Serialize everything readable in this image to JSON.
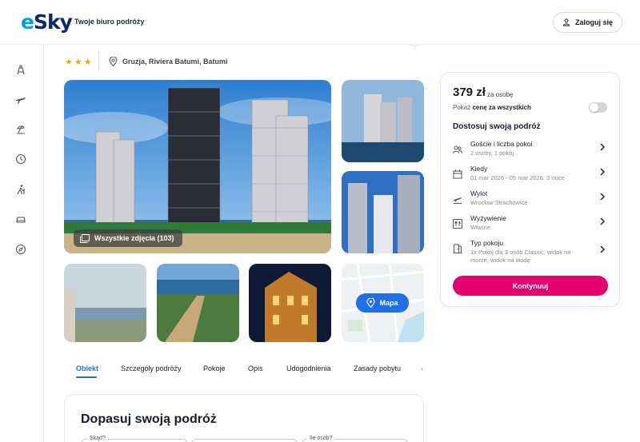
{
  "header": {
    "logo_e": "e",
    "logo_rest": "Sky",
    "tagline": "Twoje biuro podróży",
    "login_label": "Zaloguj się"
  },
  "sidebar": {
    "icons": [
      "hotel-icon",
      "flight-icon",
      "vacation-icon",
      "last-minute-icon",
      "hiking-icon",
      "car-icon",
      "explore-icon"
    ]
  },
  "hotel": {
    "stars": "★★★",
    "location": "Gruzja, Riviera Batumi, Batumi"
  },
  "gallery": {
    "all_photos_label": "Wszystkie zdjęcia (103)",
    "map_label": "Mapa"
  },
  "tabs": [
    {
      "label": "Obiekt"
    },
    {
      "label": "Szczegóły podróży"
    },
    {
      "label": "Pokoje"
    },
    {
      "label": "Opis"
    },
    {
      "label": "Udogodnienia"
    },
    {
      "label": "Zasady pobytu"
    }
  ],
  "adjust": {
    "title": "Dopasuj swoją podróż",
    "field1_label": "Skąd?",
    "field3_label": "Ile osób?"
  },
  "booking": {
    "price": "379 zł",
    "per_person": "za osobę",
    "show_prefix": "Pokaż ",
    "show_bold": "cenę za wszystkich",
    "customize_title": "Dostosuj swoją podróż",
    "options": [
      {
        "icon": "guests-icon",
        "title": "Goście i liczba pokoi",
        "sub": "2 osoby, 1 pokój"
      },
      {
        "icon": "calendar-icon",
        "title": "Kiedy",
        "sub": "01 mar 2026 - 05 mar 2026, 3 noce"
      },
      {
        "icon": "departure-icon",
        "title": "Wylot",
        "sub": "Wrocław Strachowice"
      },
      {
        "icon": "meal-icon",
        "title": "Wyżywienie",
        "sub": "Własne"
      },
      {
        "icon": "room-icon",
        "title": "Typ pokoju",
        "sub": "1x Pokój dla 3 osób Classic, widok na morze, widok na wodę"
      }
    ],
    "cta_label": "Kontynuuj"
  },
  "colors": {
    "accent_blue": "#1e6fe8",
    "cta_pink": "#e4006e",
    "star": "#f5a623"
  }
}
